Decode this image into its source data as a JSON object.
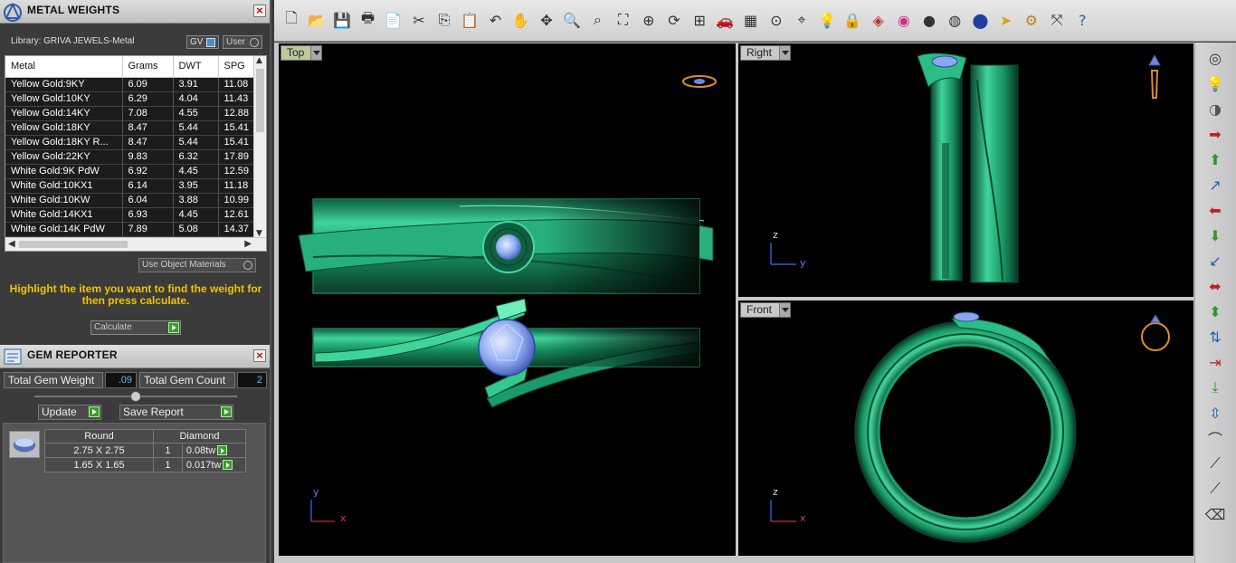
{
  "metal_panel": {
    "title": "METAL WEIGHTS",
    "library": "Library: GRIVA JEWELS-Metal",
    "gv_label": "GV",
    "user_label": "User",
    "columns": [
      "Metal",
      "Grams",
      "DWT",
      "SPG"
    ],
    "rows": [
      [
        "Yellow Gold:9KY",
        "6.09",
        "3.91",
        "11.08"
      ],
      [
        "Yellow Gold:10KY",
        "6.29",
        "4.04",
        "11.43"
      ],
      [
        "Yellow Gold:14KY",
        "7.08",
        "4.55",
        "12.88"
      ],
      [
        "Yellow Gold:18KY",
        "8.47",
        "5.44",
        "15.41"
      ],
      [
        "Yellow Gold:18KY R...",
        "8.47",
        "5.44",
        "15.41"
      ],
      [
        "Yellow Gold:22KY",
        "9.83",
        "6.32",
        "17.89"
      ],
      [
        "White Gold:9K PdW",
        "6.92",
        "4.45",
        "12.59"
      ],
      [
        "White Gold:10KX1",
        "6.14",
        "3.95",
        "11.18"
      ],
      [
        "White Gold:10KW",
        "6.04",
        "3.88",
        "10.99"
      ],
      [
        "White Gold:14KX1",
        "6.93",
        "4.45",
        "12.61"
      ],
      [
        "White Gold:14K PdW",
        "7.89",
        "5.08",
        "14.37"
      ]
    ],
    "use_object_materials": "Use Object Materials",
    "hint": "Highlight the item you want to find the weight for then press calculate.",
    "calculate_label": "Calculate"
  },
  "gem_panel": {
    "title": "GEM REPORTER",
    "total_weight_label": "Total Gem Weight",
    "total_weight_value": ".09",
    "total_count_label": "Total Gem Count",
    "total_count_value": "2",
    "update_label": "Update",
    "save_report_label": "Save Report",
    "columns": [
      "Round",
      "Diamond"
    ],
    "rows": [
      {
        "size": "2.75 X 2.75",
        "count": "1",
        "weight": "0.08tw"
      },
      {
        "size": "1.65 X 1.65",
        "count": "1",
        "weight": "0.017tw"
      }
    ]
  },
  "viewports": {
    "top": {
      "label": "Top",
      "axis_h": "x",
      "axis_v": "y"
    },
    "right": {
      "label": "Right",
      "axis_h": "y",
      "axis_v": "z"
    },
    "front": {
      "label": "Front",
      "axis_h": "x",
      "axis_v": "z"
    }
  },
  "toolbar_icons": [
    "new-file-icon",
    "open-folder-icon",
    "save-icon",
    "print-icon",
    "copy-doc-icon",
    "cut-icon",
    "copy-icon",
    "paste-icon",
    "undo-icon",
    "pan-hand-icon",
    "move-icon",
    "zoom-icon",
    "zoom-window-icon",
    "zoom-extents-icon",
    "zoom-selected-icon",
    "rotate-view-icon",
    "four-views-icon",
    "car-icon",
    "grid-plane-icon",
    "snap-icon",
    "osnap-icon",
    "light-bulb-icon",
    "lock-icon",
    "layer-icon",
    "color-wheel-icon",
    "shade-sphere-icon",
    "render-sphere-icon",
    "blue-sphere-icon",
    "spotlight-icon",
    "settings-gear-icon",
    "dimension-icon",
    "help-icon"
  ],
  "colors": {
    "ring": "#1a9a6a",
    "gem": "#8aa6ee",
    "hint_text": "#f2c300",
    "panel_bg": "#3b3b3b"
  }
}
